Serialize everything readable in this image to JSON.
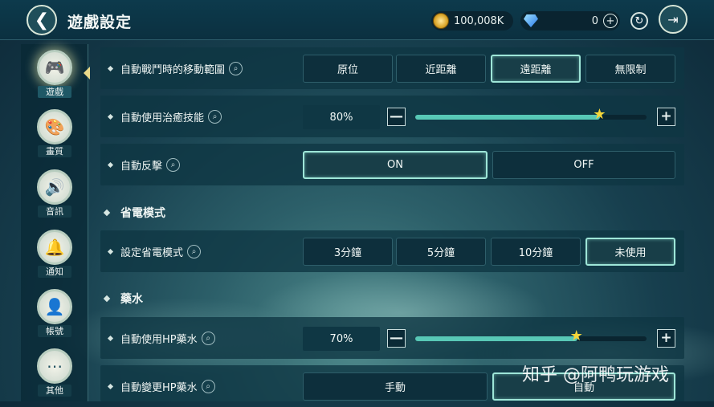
{
  "header": {
    "title": "遊戲設定",
    "back_icon": "back-arrow-icon",
    "coin_value": "100,008K",
    "gem_value": "0",
    "plus_glyph": "+",
    "refresh_glyph": "↻",
    "exit_glyph": "⇥"
  },
  "sidebar": {
    "items": [
      {
        "label": "遊戲",
        "icon": "gamepad-icon",
        "glyph": "🎮",
        "active": true
      },
      {
        "label": "畫質",
        "icon": "palette-icon",
        "glyph": "🎨",
        "active": false
      },
      {
        "label": "音訊",
        "icon": "speaker-icon",
        "glyph": "🔊",
        "active": false
      },
      {
        "label": "通知",
        "icon": "bell-icon",
        "glyph": "🔔",
        "active": false
      },
      {
        "label": "帳號",
        "icon": "user-icon",
        "glyph": "👤",
        "active": false
      },
      {
        "label": "其他",
        "icon": "more-icon",
        "glyph": "⋯",
        "active": false
      }
    ]
  },
  "settings": {
    "battle_range": {
      "label": "自動戰鬥時的移動範圍",
      "options": [
        "原位",
        "近距離",
        "遠距離",
        "無限制"
      ],
      "selected": "遠距離"
    },
    "heal_skill": {
      "label": "自動使用治癒技能",
      "value": "80%",
      "level": 0.8
    },
    "counter": {
      "label": "自動反擊",
      "options": [
        "ON",
        "OFF"
      ],
      "selected": "ON"
    },
    "power_section": "省電模式",
    "power_mode": {
      "label": "設定省電模式",
      "options": [
        "3分鐘",
        "5分鐘",
        "10分鐘",
        "未使用"
      ],
      "selected": "未使用"
    },
    "potion_section": "藥水",
    "hp_potion": {
      "label": "自動使用HP藥水",
      "value": "70%",
      "level": 0.7
    },
    "hp_potion_change": {
      "label": "自動變更HP藥水",
      "options": [
        "手動",
        "自動"
      ],
      "selected": "自動"
    }
  },
  "slider": {
    "minus_glyph": "—",
    "plus_glyph": "+",
    "star_glyph": "★"
  },
  "search_glyph": "⌕",
  "watermark": "知乎 @阿鸭玩游戏",
  "colors": {
    "accent": "#9ee6d8",
    "slider_fill": "#58c8b6",
    "star": "#f4d53a"
  }
}
